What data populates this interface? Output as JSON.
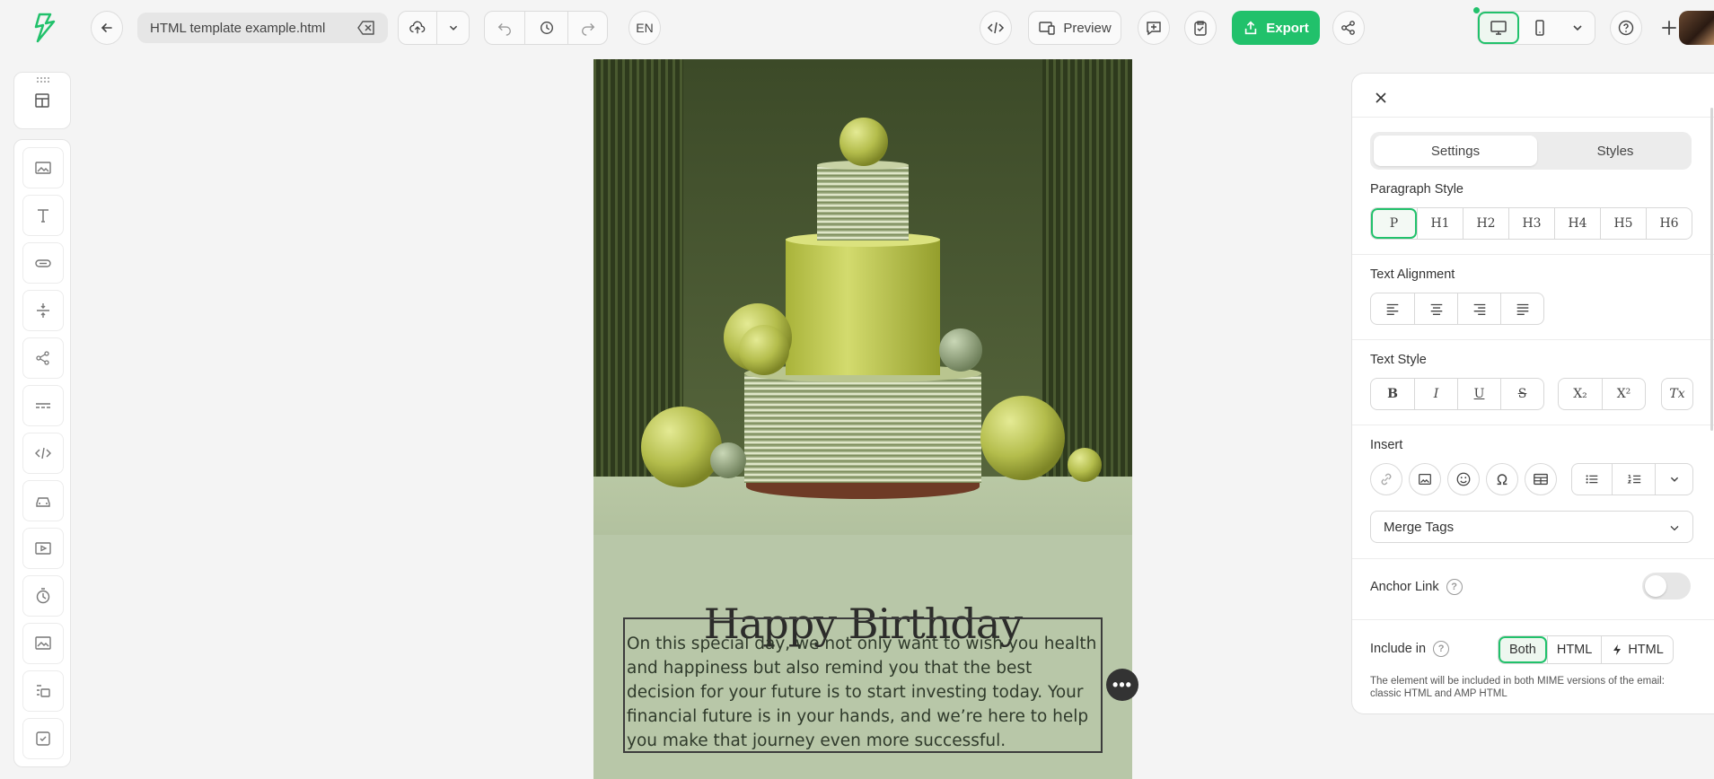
{
  "toolbar": {
    "file_name": "HTML template example.html",
    "language": "EN",
    "preview_label": "Preview",
    "export_label": "Export"
  },
  "email": {
    "heading": "Happy Birthday",
    "paragraph": "On this special day, we not only want to wish you health and happiness but also remind you that the best decision for your future is to start investing today. Your financial future is in your hands, and we’re here to help you make that journey even more successful.",
    "more_label": "•••"
  },
  "panel": {
    "tabs": [
      "Settings",
      "Styles"
    ],
    "active_tab": "Settings",
    "paragraph_style_label": "Paragraph Style",
    "paragraph_styles": [
      "P",
      "H1",
      "H2",
      "H3",
      "H4",
      "H5",
      "H6"
    ],
    "selected_paragraph_style": "P",
    "text_alignment_label": "Text Alignment",
    "text_style_label": "Text Style",
    "text_styles": [
      "B",
      "I",
      "U",
      "S"
    ],
    "script_styles": [
      "X₂",
      "X²"
    ],
    "clear_format_label": "Tx",
    "insert_label": "Insert",
    "merge_tags_label": "Merge Tags",
    "anchor_link_label": "Anchor Link",
    "anchor_link_enabled": false,
    "include_in_label": "Include in",
    "include_options": [
      "Both",
      "HTML",
      "HTML"
    ],
    "include_selected": "Both",
    "include_note": "The element will be included in both MIME versions of the email: classic HTML and AMP HTML"
  },
  "colors": {
    "accent": "#21c16b",
    "canvas_bg": "#b8c7a8",
    "hero_bg": "#4a5a34"
  }
}
